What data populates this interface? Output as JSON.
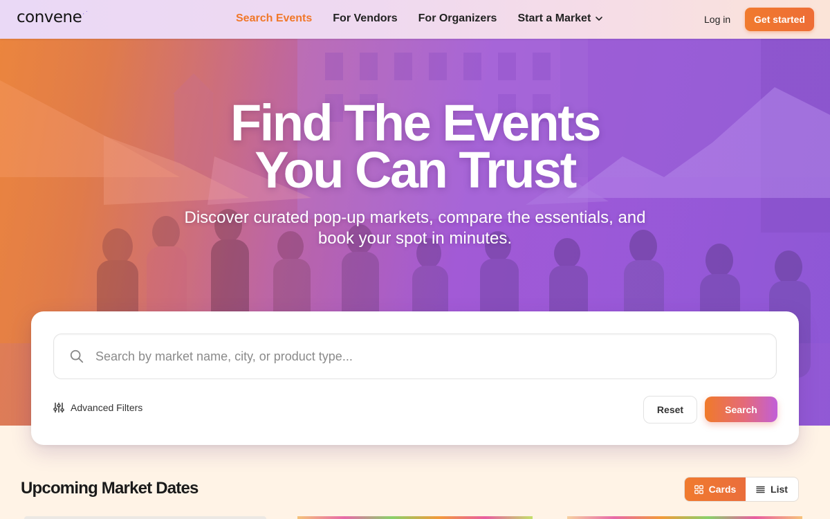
{
  "header": {
    "logo": "convene",
    "logo_accent": "·˙",
    "nav": [
      {
        "label": "Search Events",
        "active": true
      },
      {
        "label": "For Vendors",
        "active": false
      },
      {
        "label": "For Organizers",
        "active": false
      },
      {
        "label": "Start a Market",
        "active": false,
        "has_dropdown": true
      }
    ],
    "login_label": "Log in",
    "cta_label": "Get started"
  },
  "hero": {
    "title_line1": "Find The Events",
    "title_line2": "You Can Trust",
    "subtitle": "Discover curated pop-up markets, compare the essentials, and book your spot in minutes."
  },
  "search": {
    "placeholder": "Search by market name, city, or product type...",
    "value": "",
    "advanced_filters_label": "Advanced Filters",
    "reset_label": "Reset",
    "search_label": "Search"
  },
  "upcoming": {
    "title": "Upcoming Market Dates",
    "view_options": [
      {
        "label": "Cards",
        "icon": "grid-icon",
        "selected": true
      },
      {
        "label": "List",
        "icon": "list-icon",
        "selected": false
      }
    ]
  },
  "colors": {
    "accent_orange": "#f07a2e",
    "accent_purple": "#9a58d6",
    "page_bg": "#fff3e6"
  }
}
